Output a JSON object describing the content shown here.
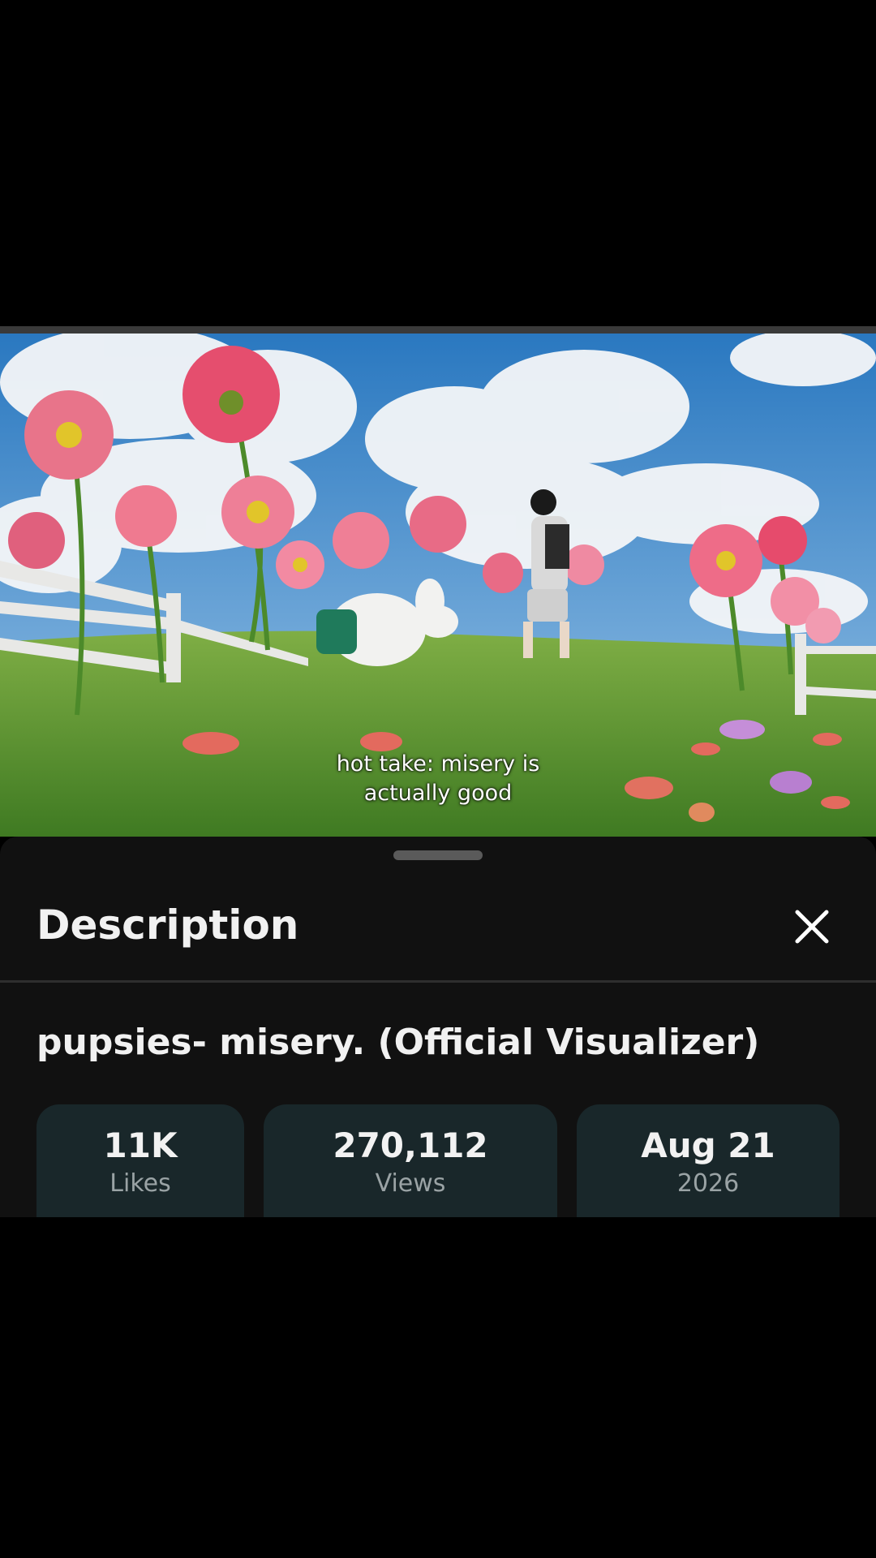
{
  "video": {
    "subtitle_line1": "hot take: misery is",
    "subtitle_line2": "actually good"
  },
  "sheet": {
    "title": "Description",
    "close_icon": "close-icon",
    "video_title": "pupsies- misery. (Official Visualizer)",
    "stats": {
      "likes": {
        "value": "11K",
        "label": "Likes"
      },
      "views": {
        "value": "270,112",
        "label": "Views"
      },
      "date": {
        "value": "Aug 21",
        "label": "2026"
      }
    }
  },
  "colors": {
    "sheet_bg": "#111111",
    "stat_bg": "#19272a",
    "stat_label": "#9aa3a5"
  }
}
